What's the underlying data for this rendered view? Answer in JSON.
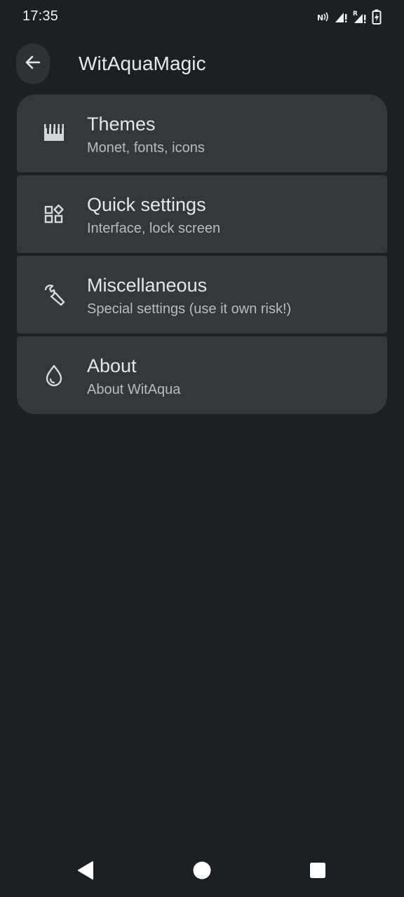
{
  "status_bar": {
    "time": "17:35",
    "icons": [
      "nfc-icon",
      "signal-icon-1",
      "signal-roaming-icon",
      "battery-charging-icon"
    ]
  },
  "app_bar": {
    "title": "WitAquaMagic",
    "back_icon": "arrow-back-icon"
  },
  "menu": {
    "items": [
      {
        "title": "Themes",
        "subtitle": "Monet, fonts, icons",
        "icon": "palette-strip-icon"
      },
      {
        "title": "Quick settings",
        "subtitle": "Interface, lock screen",
        "icon": "widgets-icon"
      },
      {
        "title": "Miscellaneous",
        "subtitle": "Special settings (use it own risk!)",
        "icon": "wrench-icon"
      },
      {
        "title": "About",
        "subtitle": "About WitAqua",
        "icon": "water-drop-icon"
      }
    ]
  },
  "nav_bar": {
    "buttons": [
      "back-triangle-icon",
      "home-circle-icon",
      "recents-square-icon"
    ]
  },
  "colors": {
    "background": "#1c2023",
    "card": "#33383c",
    "text_primary": "#e6e6e6",
    "text_secondary": "#b8bcbf"
  }
}
